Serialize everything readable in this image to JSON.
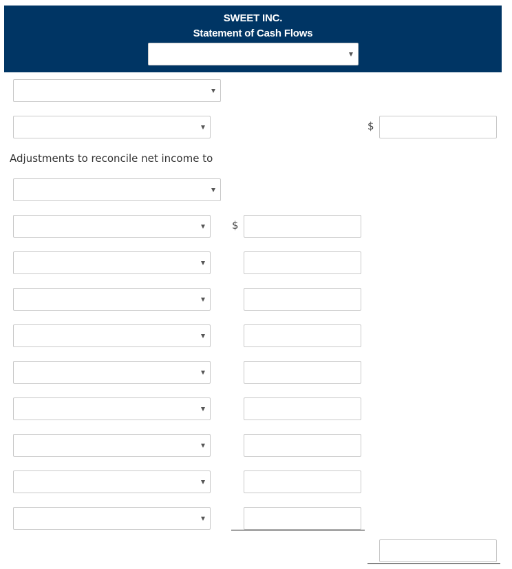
{
  "header": {
    "company": "SWEET INC.",
    "statement": "Statement of Cash Flows",
    "period_select": {
      "value": ""
    }
  },
  "rows": {
    "section_heading_select": {
      "value": ""
    },
    "net_income": {
      "select_value": "",
      "currency": "$",
      "amount": ""
    },
    "adjustments_label": "Adjustments to reconcile net income to",
    "adjustments_subheading_select": {
      "value": ""
    },
    "adjustments": [
      {
        "select_value": "",
        "currency": "$",
        "amount": ""
      },
      {
        "select_value": "",
        "amount": ""
      },
      {
        "select_value": "",
        "amount": ""
      },
      {
        "select_value": "",
        "amount": ""
      },
      {
        "select_value": "",
        "amount": ""
      },
      {
        "select_value": "",
        "amount": ""
      },
      {
        "select_value": "",
        "amount": ""
      },
      {
        "select_value": "",
        "amount": ""
      },
      {
        "select_value": "",
        "amount": ""
      }
    ],
    "total": {
      "amount": ""
    }
  },
  "icons": {
    "dropdown": "chevron-down-icon"
  }
}
